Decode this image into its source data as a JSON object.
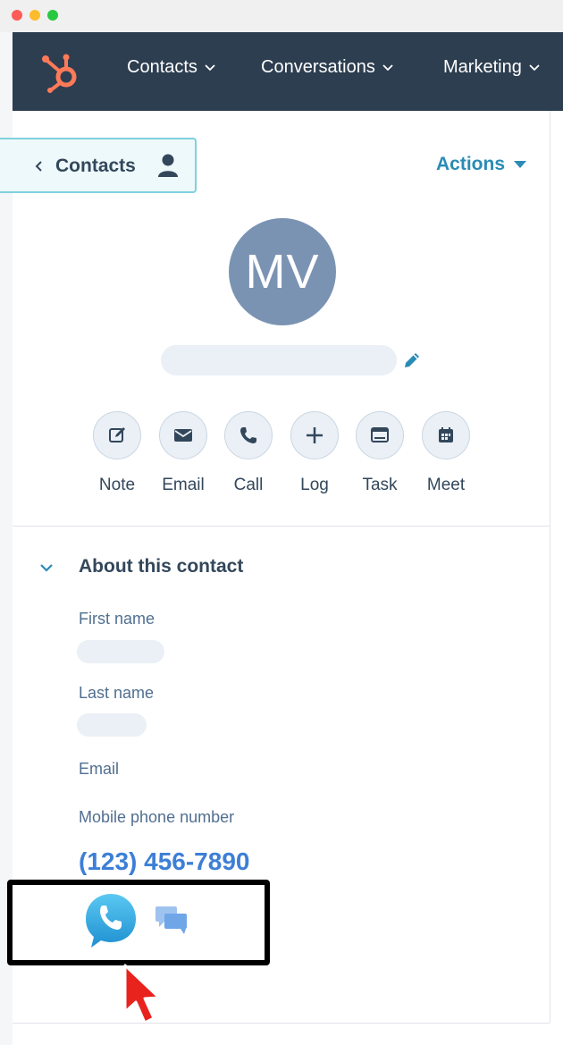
{
  "nav": {
    "items": [
      {
        "label": "Contacts"
      },
      {
        "label": "Conversations"
      },
      {
        "label": "Marketing"
      }
    ]
  },
  "header": {
    "back_label": "Contacts",
    "actions_label": "Actions"
  },
  "profile": {
    "initials": "MV"
  },
  "quick_actions": [
    {
      "label": "Note",
      "icon": "note-edit-icon"
    },
    {
      "label": "Email",
      "icon": "envelope-icon"
    },
    {
      "label": "Call",
      "icon": "phone-icon"
    },
    {
      "label": "Log",
      "icon": "plus-icon"
    },
    {
      "label": "Task",
      "icon": "task-monitor-icon"
    },
    {
      "label": "Meet",
      "icon": "calendar-icon"
    }
  ],
  "about": {
    "title": "About this contact",
    "fields": {
      "first_name_label": "First name",
      "last_name_label": "Last name",
      "email_label": "Email",
      "mobile_label": "Mobile phone number",
      "mobile_value": "(123) 456-7890"
    }
  },
  "colors": {
    "navbar": "#2d3e50",
    "accent": "#2a8bb5",
    "avatar": "#7b93b3",
    "phone_link": "#3d7fd6",
    "brand_orange": "#ff7a59"
  }
}
